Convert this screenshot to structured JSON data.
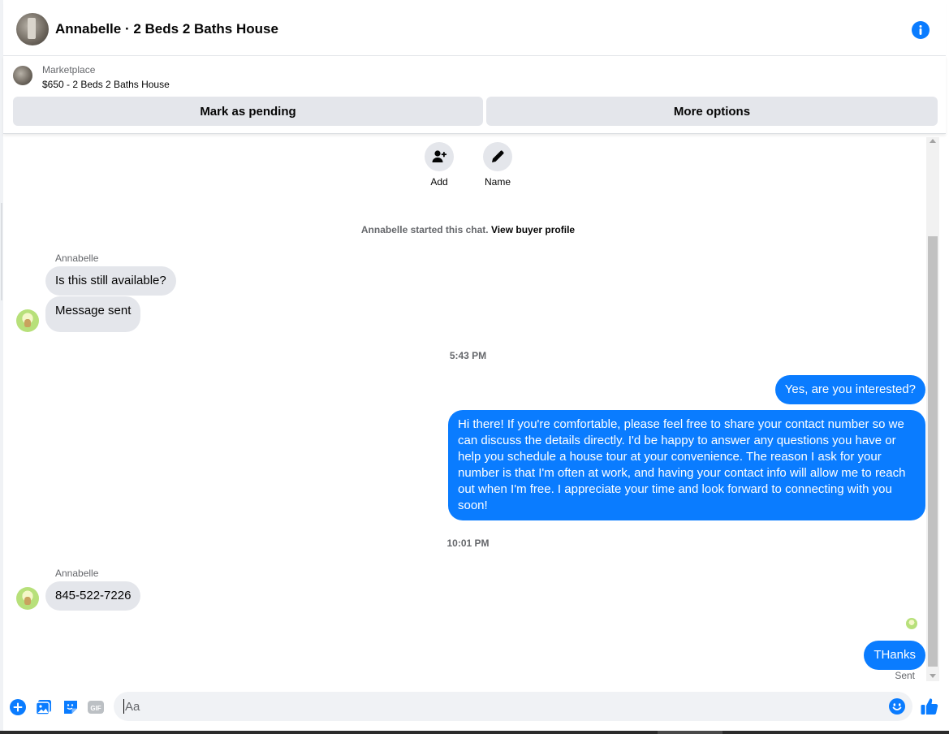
{
  "header": {
    "title": "Annabelle · 2 Beds 2 Baths House",
    "avatar_icon": "listing-photo-avatar",
    "info_icon": "info-icon"
  },
  "marketplace": {
    "label": "Marketplace",
    "listing": "$650 - 2 Beds 2 Baths House",
    "mark_pending_label": "Mark as pending",
    "more_options_label": "More options"
  },
  "actions": {
    "add_label": "Add",
    "name_label": "Name"
  },
  "system": {
    "started_text": "Annabelle started this chat.",
    "profile_link": "View buyer profile"
  },
  "messages": {
    "sender_1": "Annabelle",
    "msg_1": "Is this still available?",
    "msg_2": "Message sent",
    "time_1": "5:43 PM",
    "out_1": "Yes, are you interested?",
    "out_2": "Hi there! If you're comfortable, please feel free to share your contact number so we can discuss the details directly. I'd be happy to answer any questions you have or help you schedule a house tour at your convenience. The reason I ask for your number is that I'm often at work, and having your contact info will allow me to reach out when I'm free. I appreciate your time and look forward to connecting with you soon!",
    "time_2": "10:01 PM",
    "sender_2": "Annabelle",
    "msg_3": "845-522-7226",
    "out_3": "THanks",
    "status": "Sent"
  },
  "composer": {
    "placeholder": "Aa",
    "icons": [
      "plus-icon",
      "photo-icon",
      "sticker-icon",
      "gif-icon",
      "emoji-icon",
      "thumbs-up-icon"
    ],
    "gif_label": "GIF"
  },
  "colors": {
    "accent": "#0a7cff",
    "bubble_in": "#e4e6eb",
    "button_bg": "#e4e6eb",
    "secondary_text": "#65676b"
  }
}
